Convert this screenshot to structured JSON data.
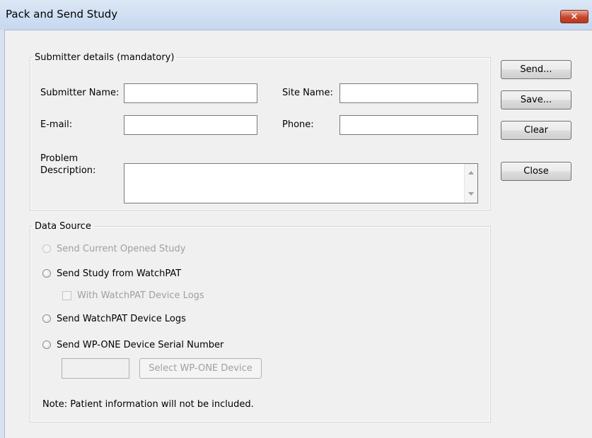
{
  "window": {
    "title": "Pack and Send Study",
    "close_symbol": "×"
  },
  "submitter": {
    "legend": "Submitter details (mandatory)",
    "name_label": "Submitter Name:",
    "site_label": "Site Name:",
    "email_label": "E-mail:",
    "phone_label": "Phone:",
    "problem_label_line1": "Problem",
    "problem_label_line2": "Description:",
    "name_value": "",
    "site_value": "",
    "email_value": "",
    "phone_value": "",
    "problem_value": ""
  },
  "buttons": {
    "send": "Send...",
    "save": "Save...",
    "clear": "Clear",
    "close": "Close"
  },
  "data_source": {
    "legend": "Data Source",
    "option_current": "Send Current Opened Study",
    "option_watchpat": "Send Study from WatchPAT",
    "with_logs": "With WatchPAT Device Logs",
    "option_logs": "Send WatchPAT Device Logs",
    "option_serial": "Send WP-ONE Device Serial Number",
    "serial_value": "",
    "select_device": "Select WP-ONE Device",
    "note": "Note: Patient information will not be included."
  }
}
